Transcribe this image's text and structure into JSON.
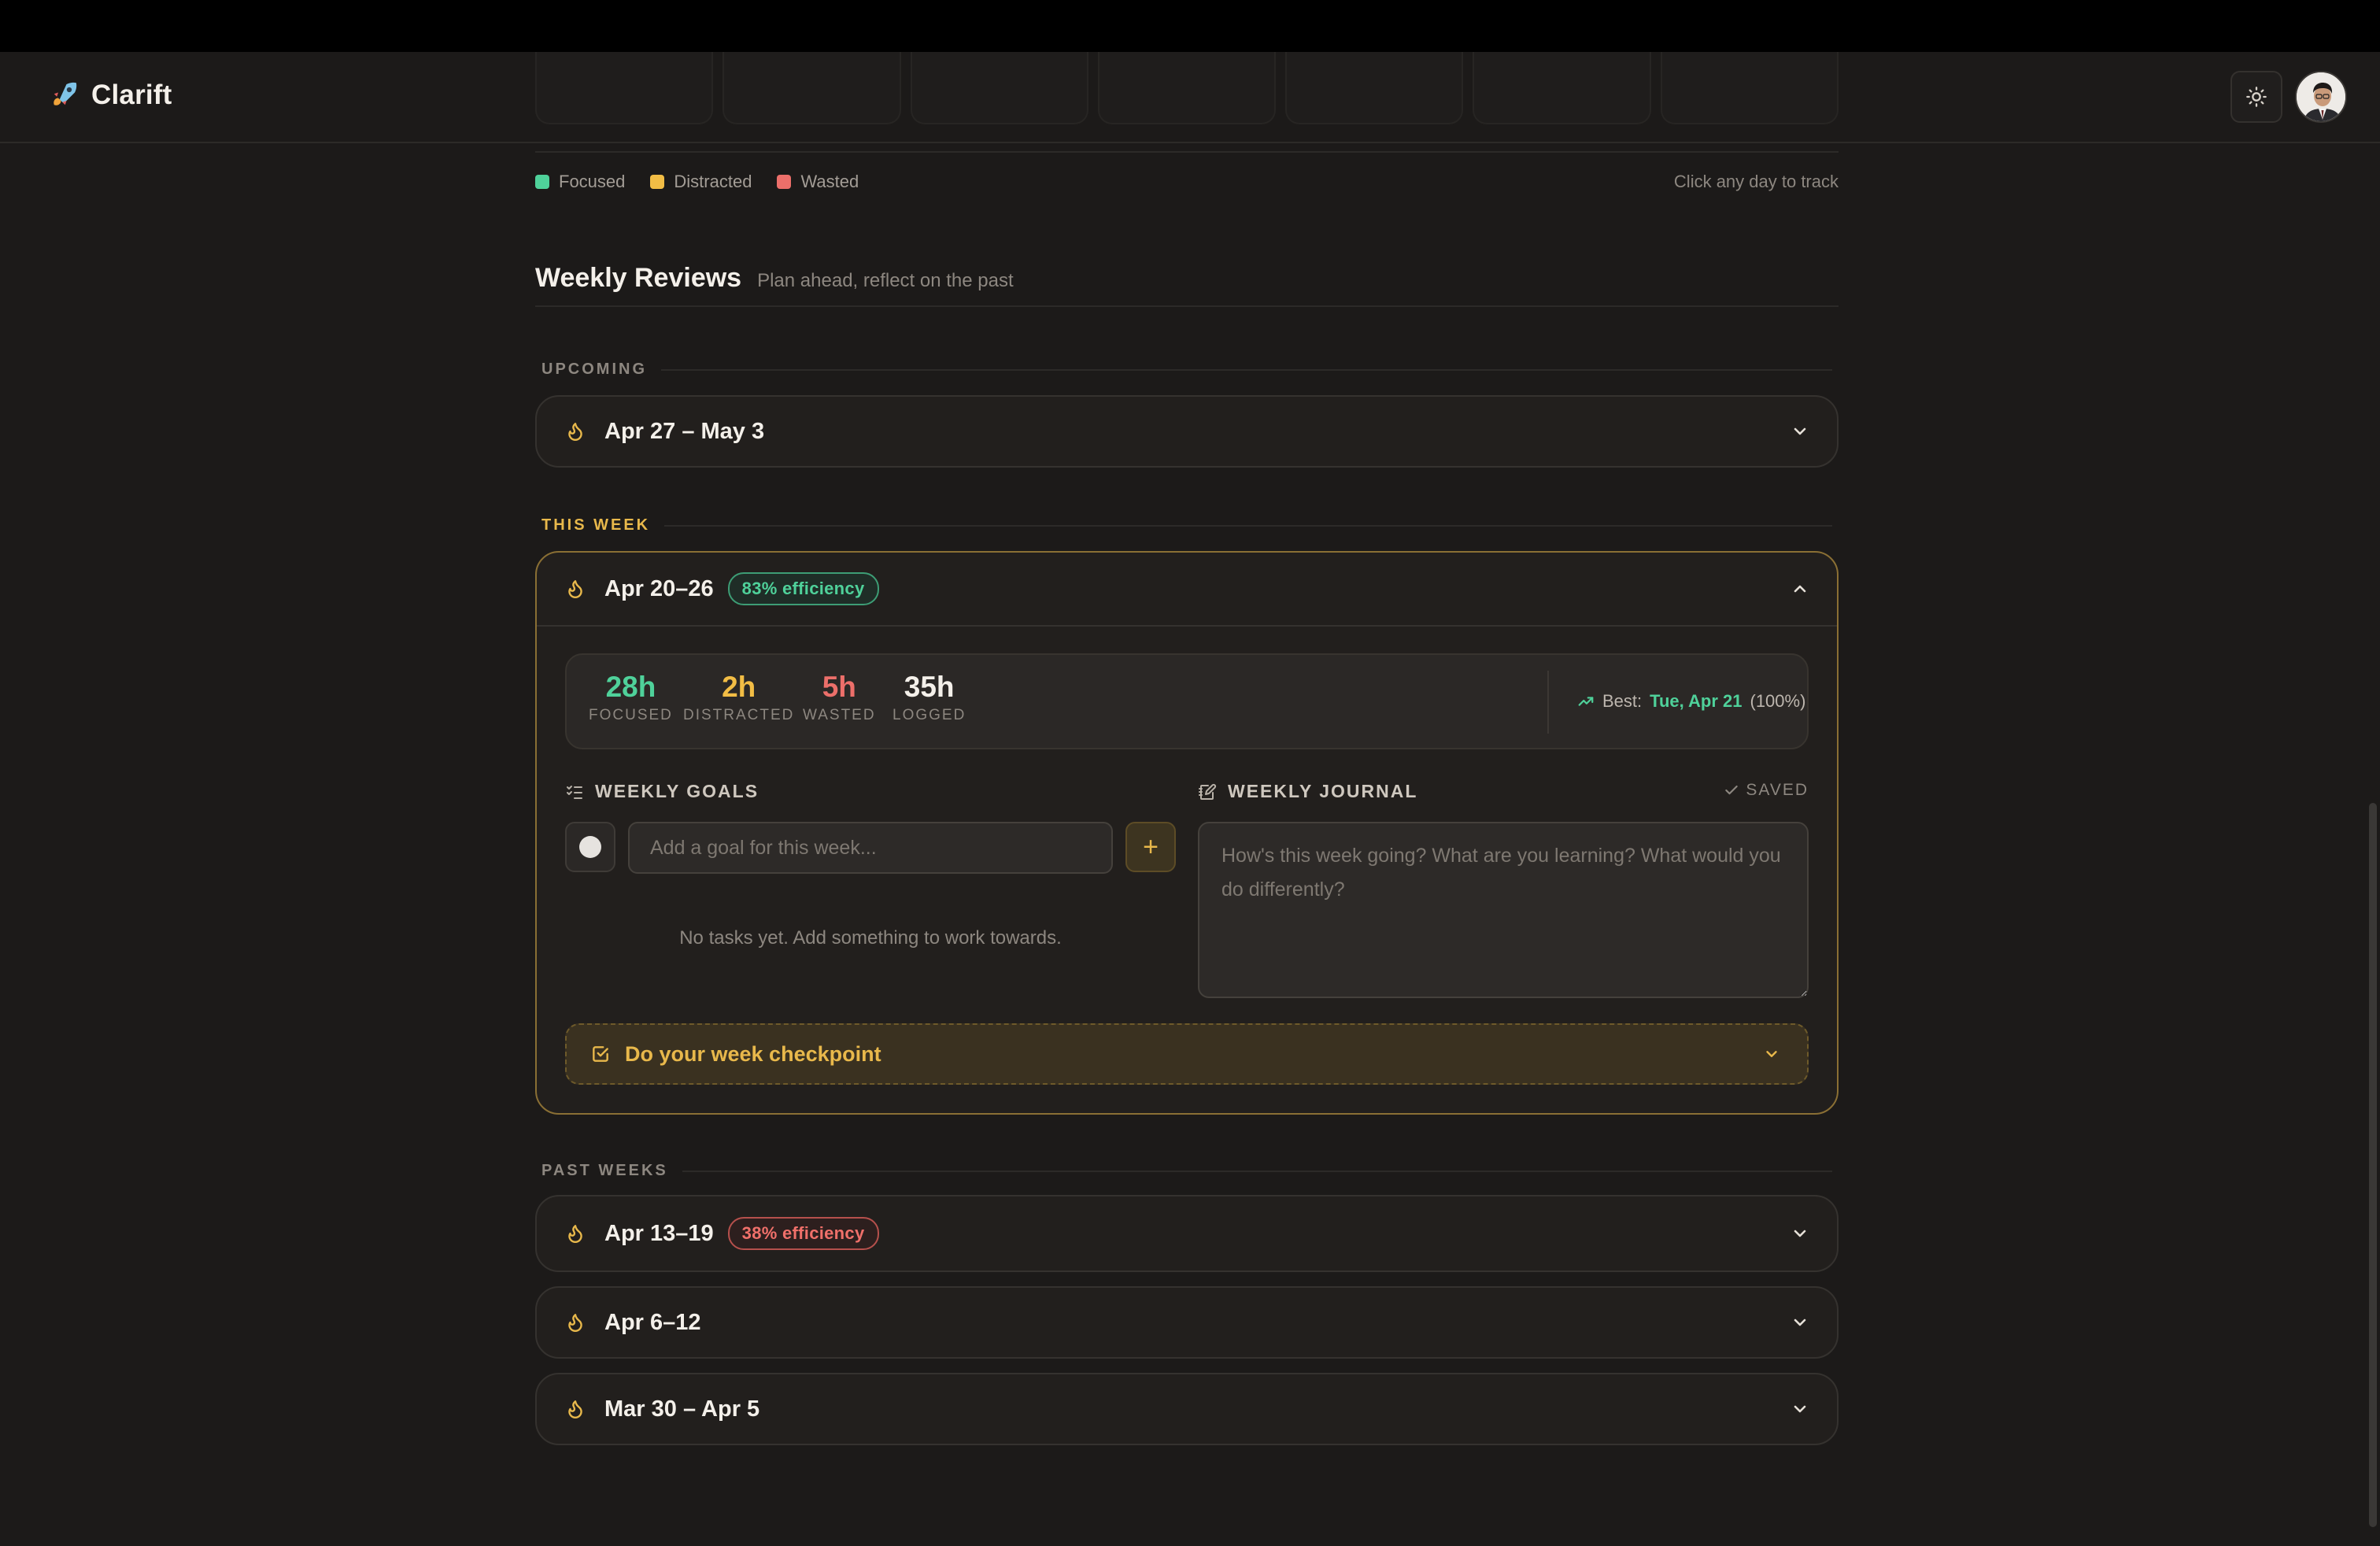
{
  "app": {
    "name": "Clarift"
  },
  "legend": {
    "items": [
      {
        "label": "Focused",
        "color": "#4fd19a"
      },
      {
        "label": "Distracted",
        "color": "#f2bd45"
      },
      {
        "label": "Wasted",
        "color": "#ec6f6a"
      }
    ],
    "hint": "Click any day to track"
  },
  "section": {
    "title": "Weekly Reviews",
    "subtitle": "Plan ahead, reflect on the past"
  },
  "groups": {
    "upcoming": "UPCOMING",
    "this_week": "THIS WEEK",
    "past": "PAST WEEKS"
  },
  "upcoming": [
    {
      "range": "Apr 27 – May 3"
    }
  ],
  "current": {
    "range": "Apr 20–26",
    "efficiency": "83% efficiency",
    "stats": [
      {
        "value": "28h",
        "label": "FOCUSED",
        "color": "#4fd19a"
      },
      {
        "value": "2h",
        "label": "DISTRACTED",
        "color": "#f2bd45"
      },
      {
        "value": "5h",
        "label": "WASTED",
        "color": "#ec6f6a"
      },
      {
        "value": "35h",
        "label": "LOGGED",
        "color": "#f4f0ea"
      }
    ],
    "best_prefix": "Best:",
    "best_day": "Tue, Apr 21",
    "best_pct": "(100%)",
    "goals_label": "WEEKLY GOALS",
    "goal_placeholder": "Add a goal for this week...",
    "add_label": "+",
    "empty_text": "No tasks yet. Add something to work towards.",
    "journal_label": "WEEKLY JOURNAL",
    "saved_label": "SAVED",
    "journal_placeholder": "How's this week going? What are you learning? What would you do differently?",
    "checkpoint_label": "Do your week checkpoint"
  },
  "past": [
    {
      "range": "Apr 13–19",
      "efficiency": "38% efficiency"
    },
    {
      "range": "Apr 6–12",
      "efficiency": ""
    },
    {
      "range": "Mar 30 – Apr 5",
      "efficiency": ""
    }
  ],
  "icons": {
    "logo": "rocket-icon",
    "theme": "sun-icon",
    "week": "flame-icon",
    "expand": "chevron-down-icon",
    "collapse": "chevron-up-icon",
    "trend": "trending-up-icon",
    "goals": "list-checks-icon",
    "journal": "notebook-pen-icon",
    "saved": "check-icon",
    "checkpoint": "square-check-icon"
  }
}
